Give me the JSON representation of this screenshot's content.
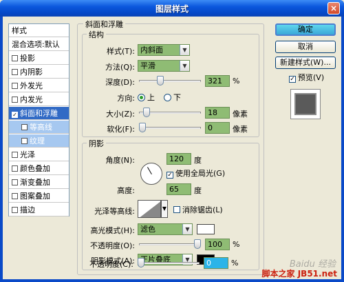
{
  "window": {
    "title": "图层样式",
    "close_glyph": "×"
  },
  "styles_list": {
    "header": "样式",
    "blend_options": "混合选项:默认",
    "items": [
      {
        "label": "投影",
        "checked": false
      },
      {
        "label": "内阴影",
        "checked": false
      },
      {
        "label": "外发光",
        "checked": false
      },
      {
        "label": "内发光",
        "checked": false
      },
      {
        "label": "斜面和浮雕",
        "checked": true
      },
      {
        "label": "等高线",
        "checked": false
      },
      {
        "label": "纹理",
        "checked": false
      },
      {
        "label": "光泽",
        "checked": false
      },
      {
        "label": "颜色叠加",
        "checked": false
      },
      {
        "label": "渐变叠加",
        "checked": false
      },
      {
        "label": "图案叠加",
        "checked": false
      },
      {
        "label": "描边",
        "checked": false
      }
    ],
    "check_glyph": "✓"
  },
  "buttons": {
    "ok": "确定",
    "cancel": "取消",
    "new_style": "新建样式(W)...",
    "preview": "预览(V)",
    "preview_checked": true
  },
  "bevel": {
    "section_title": "斜面和浮雕",
    "structure": {
      "title": "结构",
      "style_label": "样式(T):",
      "style_value": "内斜面",
      "method_label": "方法(Q):",
      "method_value": "平滑",
      "depth_label": "深度(D):",
      "depth_value": "321",
      "depth_unit": "%",
      "depth_fraction": 0.32,
      "direction_label": "方向:",
      "direction_up": "上",
      "direction_down": "下",
      "direction_selected": "上",
      "size_label": "大小(Z):",
      "size_value": "18",
      "size_unit": "像素",
      "size_fraction": 0.08,
      "soften_label": "软化(F):",
      "soften_value": "0",
      "soften_unit": "像素",
      "soften_fraction": 0
    },
    "shading": {
      "title": "阴影",
      "angle_label": "角度(N):",
      "angle_value": "120",
      "angle_unit": "度",
      "global_light_label": "使用全局光(G)",
      "global_light_checked": true,
      "altitude_label": "高度:",
      "altitude_value": "65",
      "altitude_unit": "度",
      "gloss_contour_label": "光泽等高线:",
      "anti_alias_label": "消除锯齿(L)",
      "anti_alias_checked": false,
      "highlight_mode_label": "高光模式(H):",
      "highlight_mode_value": "滤色",
      "highlight_color": "#ffffff",
      "highlight_opacity_label": "不透明度(O):",
      "highlight_opacity_value": "100",
      "highlight_opacity_unit": "%",
      "highlight_opacity_fraction": 1.0,
      "shadow_mode_label": "阴影模式(A):",
      "shadow_mode_value": "正片叠底",
      "shadow_color": "#000000",
      "shadow_opacity_label": "不透明度(C):",
      "shadow_opacity_value": "0",
      "shadow_opacity_unit": "%",
      "shadow_opacity_fraction": 0
    }
  },
  "watermark": {
    "text": "Baidu 经验",
    "site": "脚本之家 JB51.net"
  }
}
